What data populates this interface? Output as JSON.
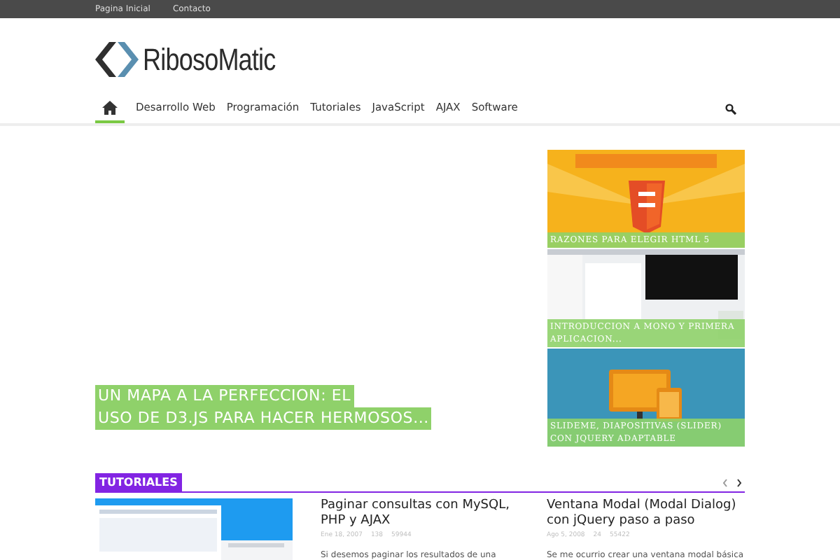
{
  "top_bar": {
    "links": [
      "Pagina Inicial",
      "Contacto"
    ]
  },
  "logo": {
    "text": "RibosoMatic"
  },
  "nav": {
    "items": [
      {
        "kind": "home",
        "selected": true
      },
      {
        "kind": "text",
        "label": "Desarrollo Web",
        "selected": false
      },
      {
        "kind": "text",
        "label": "Programación",
        "selected": false
      },
      {
        "kind": "text",
        "label": "Tutoriales",
        "selected": false
      },
      {
        "kind": "text",
        "label": "JavaScript",
        "selected": false
      },
      {
        "kind": "text",
        "label": "AJAX",
        "selected": false
      },
      {
        "kind": "text",
        "label": "Software",
        "selected": false
      }
    ]
  },
  "featured": {
    "title_lines": [
      "UN MAPA A LA PERFECCION: EL",
      "USO DE D3.JS PARA HACER HERMOSOS..."
    ]
  },
  "side_posts": [
    {
      "kind": "picture",
      "caption": "RAZONES PARA ELEGIR HTML 5"
    },
    {
      "kind": "picture",
      "caption": "INTRODUCCION A MONO Y PRIMERA APLICACION..."
    },
    {
      "kind": "picture",
      "caption": "SLIDEME, DIAPOSITIVAS (SLIDER) CON JQUERY ADAPTABLE"
    }
  ],
  "section": {
    "title": "TUTORIALES",
    "color": "#8224e3"
  },
  "posts": [
    {
      "title": "Paginar consultas con MySQL, PHP y AJAX",
      "date": "Ene 18, 2007",
      "comments": "138",
      "views": "59944",
      "excerpt": "Si desemos paginar los resultados de una"
    },
    {
      "title": "Ventana Modal (Modal Dialog) con jQuery paso a paso",
      "date": "Ago 5, 2008",
      "comments": "24",
      "views": "55422",
      "excerpt": "Se me ocurrio crear una ventana modal básica"
    }
  ]
}
